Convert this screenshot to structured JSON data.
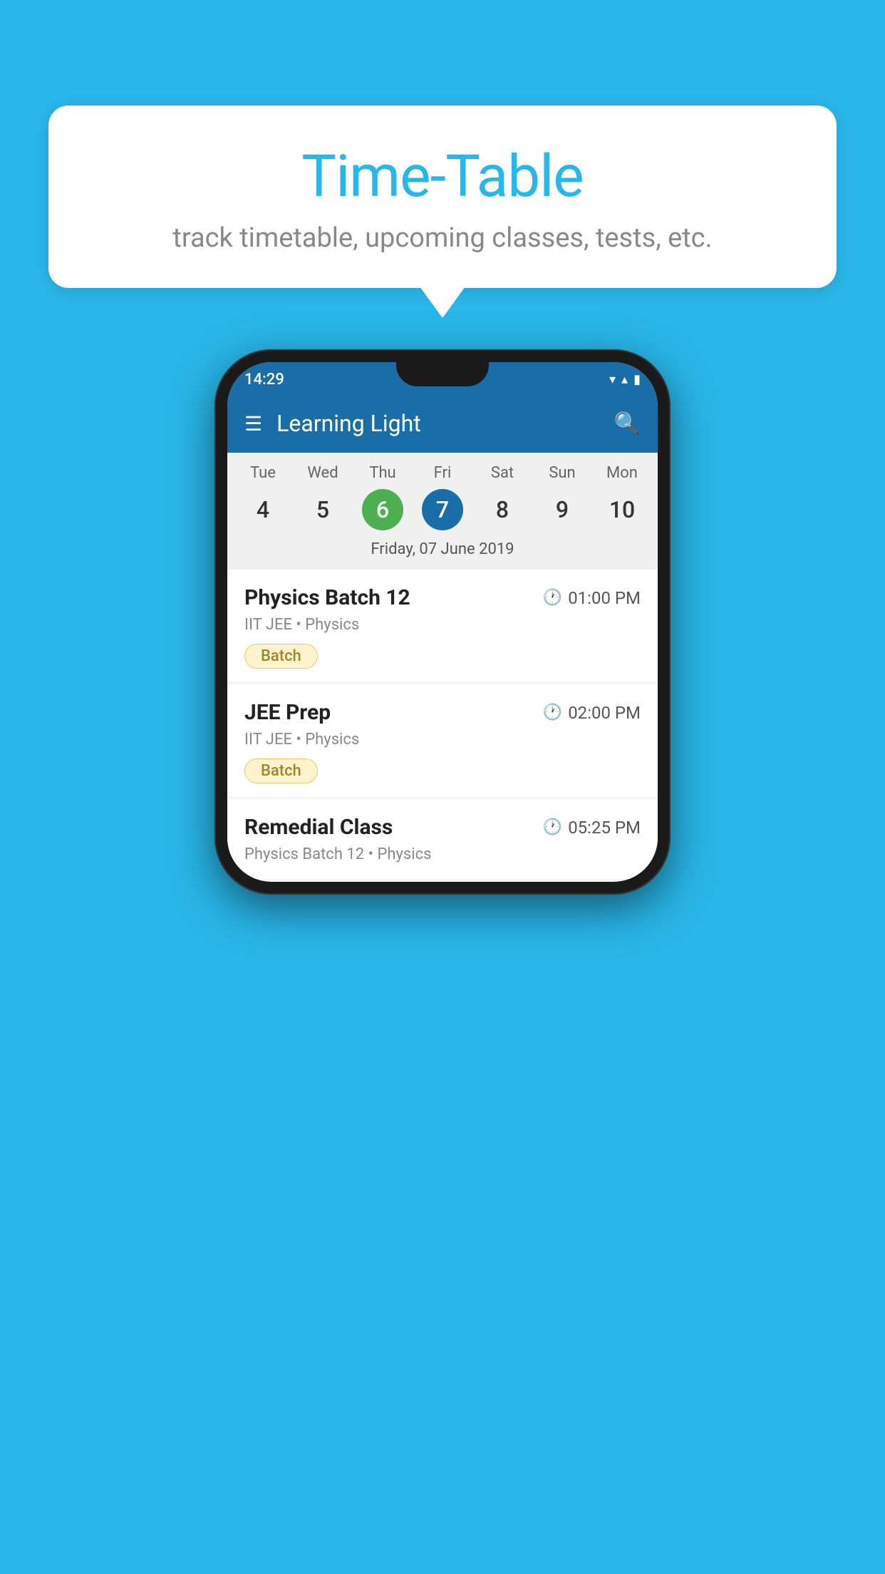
{
  "background_color": "#29b6e8",
  "speech_bubble": {
    "title": "Time-Table",
    "subtitle": "track timetable, upcoming classes, tests, etc."
  },
  "phone": {
    "status_bar": {
      "time": "14:29",
      "icons": [
        "wifi",
        "signal",
        "battery"
      ]
    },
    "header": {
      "title": "Learning Light",
      "hamburger_label": "☰",
      "search_label": "🔍"
    },
    "calendar": {
      "days": [
        {
          "name": "Tue",
          "num": "4",
          "state": "normal"
        },
        {
          "name": "Wed",
          "num": "5",
          "state": "normal"
        },
        {
          "name": "Thu",
          "num": "6",
          "state": "today"
        },
        {
          "name": "Fri",
          "num": "7",
          "state": "selected"
        },
        {
          "name": "Sat",
          "num": "8",
          "state": "normal"
        },
        {
          "name": "Sun",
          "num": "9",
          "state": "normal"
        },
        {
          "name": "Mon",
          "num": "10",
          "state": "normal"
        }
      ],
      "selected_date_label": "Friday, 07 June 2019"
    },
    "classes": [
      {
        "name": "Physics Batch 12",
        "time": "01:00 PM",
        "subject_line": "IIT JEE • Physics",
        "badge": "Batch"
      },
      {
        "name": "JEE Prep",
        "time": "02:00 PM",
        "subject_line": "IIT JEE • Physics",
        "badge": "Batch"
      },
      {
        "name": "Remedial Class",
        "time": "05:25 PM",
        "subject_line": "Physics Batch 12 • Physics",
        "badge": null
      }
    ]
  }
}
